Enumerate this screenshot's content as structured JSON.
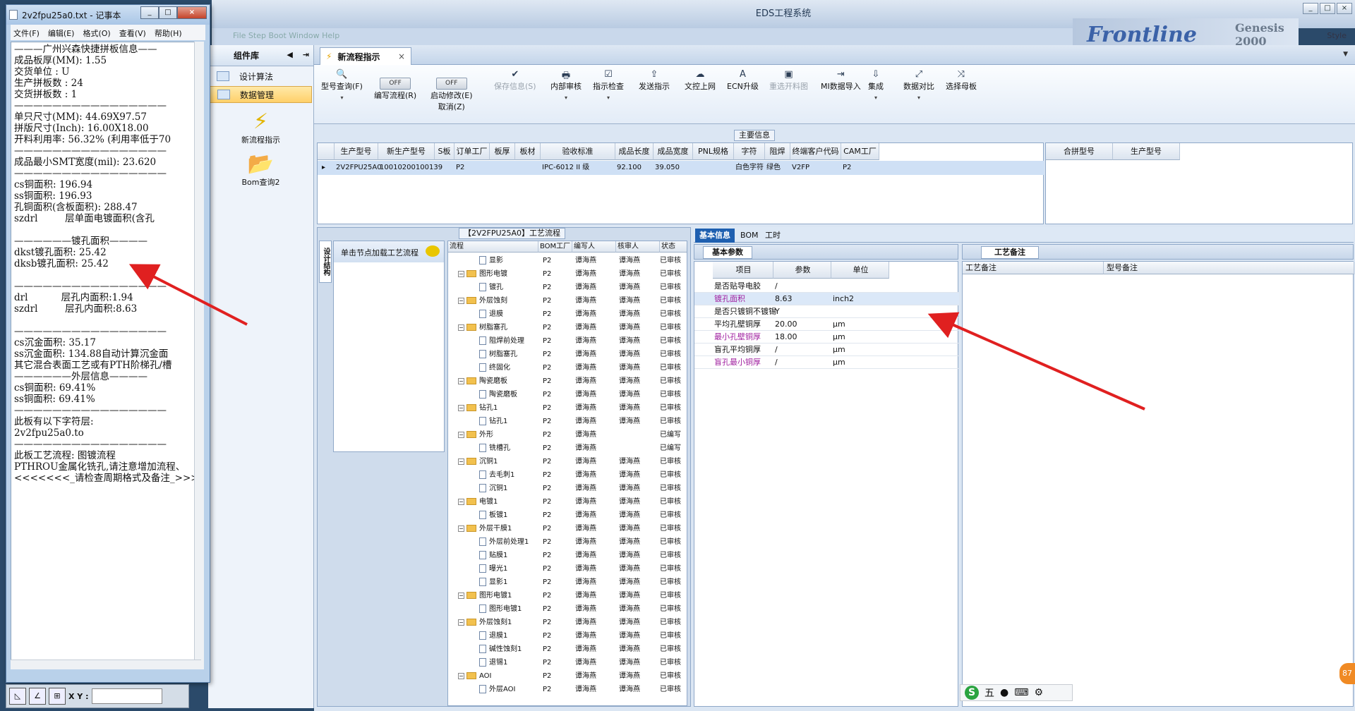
{
  "background": {
    "title": "EDS工程系统",
    "style_label": "Style",
    "brand_text": "Frontline",
    "brand_sub": "Genesis 2000",
    "ghost_menu": "File  Step  Boot  Window                                                    Help"
  },
  "notepad": {
    "title": "2v2fpu25a0.txt - 记事本",
    "menu": [
      "文件(F)",
      "编辑(E)",
      "格式(O)",
      "查看(V)",
      "帮助(H)"
    ],
    "content": "———广州兴森快捷拼板信息——\n成品板厚(MM): 1.55\n交货单位 : U\n生产拼板数 : 24\n交货拼板数 : 1\n————————————————\n单只尺寸(MM): 44.69X97.57\n拼版尺寸(Inch): 16.00X18.00\n开料利用率: 56.32% (利用率低于70\n————————————————\n成品最小SMT宽度(mil): 23.620\n————————————————\ncs铜面积: 196.94\nss铜面积: 196.93\n孔铜面积(含板面积): 288.47\nszdrl         层单面电镀面积(含孔\n\n——————镀孔面积————\ndkst镀孔面积: 25.42\ndksb镀孔面积: 25.42\n\n————————————————\ndrl           层孔内面积:1.94\nszdrl         层孔内面积:8.63\n\n————————————————\ncs沉金面积: 35.17\nss沉金面积: 134.88自动计算沉金面\n其它混合表面工艺或有PTH阶梯孔/槽\n——————外层信息————\ncs铜面积: 69.41%\nss铜面积: 69.41%\n————————————————\n此板有以下字符层:\n2v2fpu25a0.to\n————————————————\n此板工艺流程: 图镀流程\nPTHROU金属化铣孔,请注意增加流程、\n<<<<<<<_请检查周期格式及备注_>>>"
  },
  "bottomstrip": {
    "xy_label": "X Y :",
    "xy_value": ""
  },
  "leftpane": {
    "title": "组件库",
    "buttons": [
      "设计算法",
      "数据管理"
    ],
    "tools": [
      "新流程指示",
      "Bom查询2"
    ]
  },
  "tab": {
    "label": "新流程指示",
    "close": "×"
  },
  "toolbar": {
    "items": [
      {
        "label": "型号查询(F)",
        "glyph": "🔍",
        "dd": "▾"
      },
      {
        "label": "编写流程(R)",
        "toggle": "OFF"
      },
      {
        "label": "启动修改(E)",
        "label2": "取消(Z)",
        "toggle": "OFF"
      },
      {
        "label": "保存信息(S)",
        "glyph": "✔",
        "disabled": true
      },
      {
        "label": "内部审核",
        "glyph": "🖶",
        "dd": "▾"
      },
      {
        "label": "指示检查",
        "glyph": "☑",
        "dd": "▾"
      },
      {
        "label": "发送指示",
        "glyph": "⇪"
      },
      {
        "label": "文控上网",
        "glyph": "☁"
      },
      {
        "label": "ECN升级",
        "glyph": "A"
      },
      {
        "label": "重选开料图",
        "glyph": "▣",
        "disabled": true
      },
      {
        "label": "MI数据导入",
        "glyph": "⇥"
      },
      {
        "label": "集成",
        "glyph": "⇩",
        "dd": "▾"
      },
      {
        "label": "数据对比",
        "glyph": "⤢",
        "dd": "▾"
      },
      {
        "label": "选择母板",
        "glyph": "⤨"
      }
    ]
  },
  "maininfo": {
    "title": "主要信息",
    "columns": [
      "生产型号",
      "新生产型号",
      "S板",
      "订单工厂",
      "板厚",
      "板材",
      "验收标准",
      "成品长度",
      "成品宽度",
      "PNL规格",
      "字符",
      "阻焊",
      "终端客户代码",
      "CAM工厂"
    ],
    "row": [
      "2V2FPU25A0",
      "10010200100139",
      "",
      "P2",
      "",
      "",
      "IPC-6012 II 级",
      "92.100",
      "39.050",
      "",
      "白色字符",
      "绿色",
      "V2FP",
      "P2"
    ],
    "right_columns": [
      "合拼型号",
      "生产型号"
    ]
  },
  "flow": {
    "title": "【2V2FPU25A0】工艺流程",
    "side_tab": "设计结构",
    "load_hint": "单击节点加载工艺流程",
    "columns": [
      "流程",
      "BOM工厂",
      "编写人",
      "核审人",
      "状态"
    ],
    "rows": [
      {
        "level": 2,
        "name": "显影",
        "f": "P2",
        "w": "谭海燕",
        "r": "谭海燕",
        "s": "已审核"
      },
      {
        "level": 1,
        "name": "图形电镀",
        "f": "P2",
        "w": "谭海燕",
        "r": "谭海燕",
        "s": "已审核"
      },
      {
        "level": 2,
        "name": "镀孔",
        "f": "P2",
        "w": "谭海燕",
        "r": "谭海燕",
        "s": "已审核"
      },
      {
        "level": 1,
        "name": "外层蚀刻",
        "f": "P2",
        "w": "谭海燕",
        "r": "谭海燕",
        "s": "已审核"
      },
      {
        "level": 2,
        "name": "退膜",
        "f": "P2",
        "w": "谭海燕",
        "r": "谭海燕",
        "s": "已审核"
      },
      {
        "level": 1,
        "name": "树脂塞孔",
        "f": "P2",
        "w": "谭海燕",
        "r": "谭海燕",
        "s": "已审核"
      },
      {
        "level": 2,
        "name": "阻焊前处理",
        "f": "P2",
        "w": "谭海燕",
        "r": "谭海燕",
        "s": "已审核"
      },
      {
        "level": 2,
        "name": "树脂塞孔",
        "f": "P2",
        "w": "谭海燕",
        "r": "谭海燕",
        "s": "已审核"
      },
      {
        "level": 2,
        "name": "终固化",
        "f": "P2",
        "w": "谭海燕",
        "r": "谭海燕",
        "s": "已审核"
      },
      {
        "level": 1,
        "name": "陶瓷磨板",
        "f": "P2",
        "w": "谭海燕",
        "r": "谭海燕",
        "s": "已审核"
      },
      {
        "level": 2,
        "name": "陶瓷磨板",
        "f": "P2",
        "w": "谭海燕",
        "r": "谭海燕",
        "s": "已审核"
      },
      {
        "level": 1,
        "name": "钻孔1",
        "f": "P2",
        "w": "谭海燕",
        "r": "谭海燕",
        "s": "已审核"
      },
      {
        "level": 2,
        "name": "钻孔1",
        "f": "P2",
        "w": "谭海燕",
        "r": "谭海燕",
        "s": "已审核"
      },
      {
        "level": 1,
        "name": "外形",
        "f": "P2",
        "w": "谭海燕",
        "r": "",
        "s": "已编写"
      },
      {
        "level": 2,
        "name": "铣槽孔",
        "f": "P2",
        "w": "谭海燕",
        "r": "",
        "s": "已编写"
      },
      {
        "level": 1,
        "name": "沉铜1",
        "f": "P2",
        "w": "谭海燕",
        "r": "谭海燕",
        "s": "已审核"
      },
      {
        "level": 2,
        "name": "去毛刺1",
        "f": "P2",
        "w": "谭海燕",
        "r": "谭海燕",
        "s": "已审核"
      },
      {
        "level": 2,
        "name": "沉铜1",
        "f": "P2",
        "w": "谭海燕",
        "r": "谭海燕",
        "s": "已审核"
      },
      {
        "level": 1,
        "name": "电镀1",
        "f": "P2",
        "w": "谭海燕",
        "r": "谭海燕",
        "s": "已审核"
      },
      {
        "level": 2,
        "name": "板镀1",
        "f": "P2",
        "w": "谭海燕",
        "r": "谭海燕",
        "s": "已审核"
      },
      {
        "level": 1,
        "name": "外层干膜1",
        "f": "P2",
        "w": "谭海燕",
        "r": "谭海燕",
        "s": "已审核"
      },
      {
        "level": 2,
        "name": "外层前处理1",
        "f": "P2",
        "w": "谭海燕",
        "r": "谭海燕",
        "s": "已审核"
      },
      {
        "level": 2,
        "name": "贴膜1",
        "f": "P2",
        "w": "谭海燕",
        "r": "谭海燕",
        "s": "已审核"
      },
      {
        "level": 2,
        "name": "曝光1",
        "f": "P2",
        "w": "谭海燕",
        "r": "谭海燕",
        "s": "已审核"
      },
      {
        "level": 2,
        "name": "显影1",
        "f": "P2",
        "w": "谭海燕",
        "r": "谭海燕",
        "s": "已审核"
      },
      {
        "level": 1,
        "name": "图形电镀1",
        "f": "P2",
        "w": "谭海燕",
        "r": "谭海燕",
        "s": "已审核"
      },
      {
        "level": 2,
        "name": "图形电镀1",
        "f": "P2",
        "w": "谭海燕",
        "r": "谭海燕",
        "s": "已审核"
      },
      {
        "level": 1,
        "name": "外层蚀刻1",
        "f": "P2",
        "w": "谭海燕",
        "r": "谭海燕",
        "s": "已审核"
      },
      {
        "level": 2,
        "name": "退膜1",
        "f": "P2",
        "w": "谭海燕",
        "r": "谭海燕",
        "s": "已审核"
      },
      {
        "level": 2,
        "name": "碱性蚀刻1",
        "f": "P2",
        "w": "谭海燕",
        "r": "谭海燕",
        "s": "已审核"
      },
      {
        "level": 2,
        "name": "退锡1",
        "f": "P2",
        "w": "谭海燕",
        "r": "谭海燕",
        "s": "已审核"
      },
      {
        "level": 1,
        "name": "AOI",
        "f": "P2",
        "w": "谭海燕",
        "r": "谭海燕",
        "s": "已审核"
      },
      {
        "level": 2,
        "name": "外层AOI",
        "f": "P2",
        "w": "谭海燕",
        "r": "谭海燕",
        "s": "已审核"
      }
    ]
  },
  "basic": {
    "tabs": [
      "基本信息",
      "BOM",
      "工时"
    ],
    "param_title": "基本参数",
    "param_columns": [
      "项目",
      "参数",
      "单位"
    ],
    "params": [
      {
        "item": "是否贴导电胶",
        "value": "/",
        "unit": "",
        "purple": false
      },
      {
        "item": "镀孔面积",
        "value": "8.63",
        "unit": "inch2",
        "purple": true
      },
      {
        "item": "是否只镀铜不镀锡",
        "value": "Y",
        "unit": "",
        "purple": false
      },
      {
        "item": "平均孔壁铜厚",
        "value": "20.00",
        "unit": "μm",
        "purple": false
      },
      {
        "item": "最小孔壁铜厚",
        "value": "18.00",
        "unit": "μm",
        "purple": true
      },
      {
        "item": "盲孔平均铜厚",
        "value": "/",
        "unit": "μm",
        "purple": false
      },
      {
        "item": "盲孔最小铜厚",
        "value": "/",
        "unit": "μm",
        "purple": true
      }
    ],
    "note_title": "工艺备注",
    "note_columns": [
      "工艺备注",
      "型号备注"
    ]
  },
  "ime": {
    "mode": "五"
  },
  "badge": "87"
}
